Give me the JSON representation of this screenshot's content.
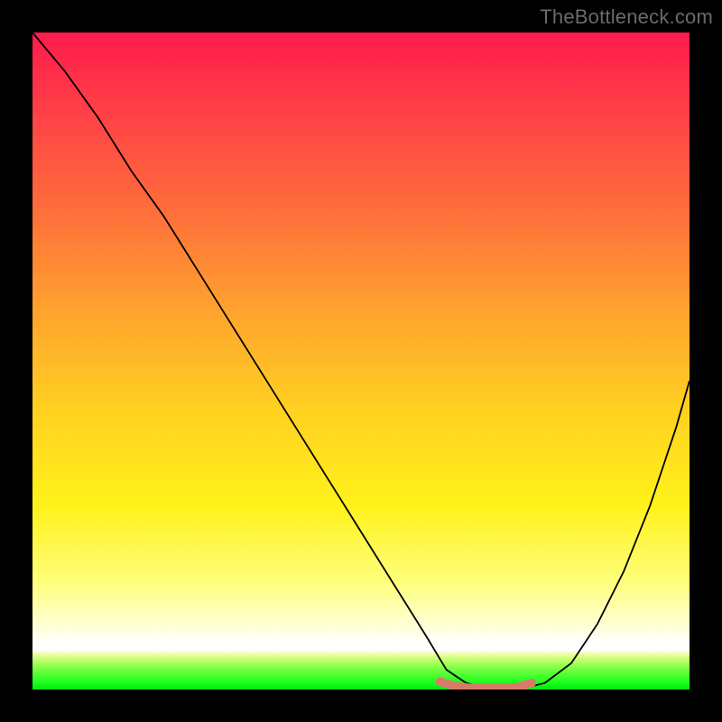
{
  "watermark": "TheBottleneck.com",
  "chart_data": {
    "type": "line",
    "title": "",
    "xlabel": "",
    "ylabel": "",
    "xlim": [
      0,
      100
    ],
    "ylim": [
      0,
      100
    ],
    "grid": false,
    "legend": false,
    "background_gradient": {
      "orientation": "vertical",
      "stops": [
        {
          "pos": 0,
          "color": "#ff1a4c"
        },
        {
          "pos": 26,
          "color": "#ff6a3c"
        },
        {
          "pos": 58,
          "color": "#ffd220"
        },
        {
          "pos": 84,
          "color": "#ffff80"
        },
        {
          "pos": 93,
          "color": "#ffffff"
        },
        {
          "pos": 100,
          "color": "#00e810"
        }
      ]
    },
    "series": [
      {
        "name": "bottleneck-curve",
        "color": "#000000",
        "x": [
          0,
          5,
          10,
          15,
          20,
          25,
          30,
          35,
          40,
          45,
          50,
          55,
          60,
          63,
          66,
          70,
          74,
          78,
          82,
          86,
          90,
          94,
          98,
          100
        ],
        "y": [
          100,
          94,
          87,
          79,
          72,
          64,
          56,
          48,
          40,
          32,
          24,
          16,
          8,
          3,
          1,
          0,
          0,
          1,
          4,
          10,
          18,
          28,
          40,
          47
        ]
      },
      {
        "name": "min-plateau-marker",
        "color": "#d97a68",
        "stroke_width": 6,
        "x": [
          62,
          64,
          66,
          68,
          70,
          72,
          74,
          76
        ],
        "y": [
          1.2,
          0.6,
          0.3,
          0.2,
          0.2,
          0.2,
          0.4,
          1.0
        ]
      }
    ]
  }
}
